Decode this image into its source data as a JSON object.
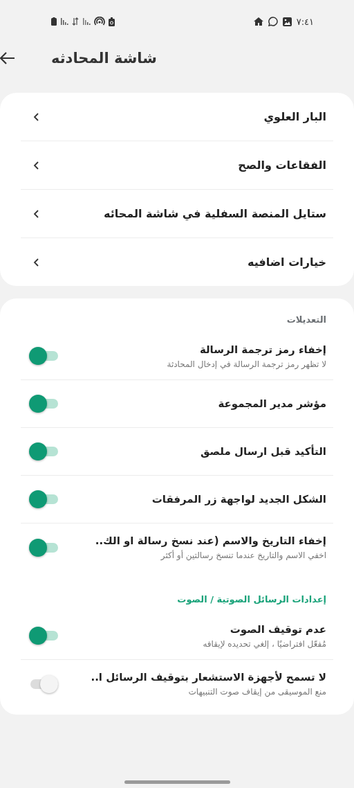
{
  "status_bar": {
    "time": "٧:٤١"
  },
  "header": {
    "title": "شاشة المحادثه"
  },
  "nav_items": [
    {
      "label": "البار العلوي"
    },
    {
      "label": "الفقاعات والصح"
    },
    {
      "label": "ستايل المنصة السفلية في شاشة المحائه"
    },
    {
      "label": "خيارات اضافيه"
    }
  ],
  "settings": [
    {
      "kind": "header",
      "label": "التعديلات",
      "color": "#6b6f73"
    },
    {
      "kind": "toggle",
      "label": "إخفاء رمز ترجمة الرسالة",
      "subtitle": "لا تظهر رمز ترجمة الرسالة في إدخال المحادثة",
      "on": true
    },
    {
      "kind": "toggle",
      "label": "مؤشر مدير المجموعة",
      "on": true
    },
    {
      "kind": "toggle",
      "label": "التأكيد قبل ارسال ملصق",
      "on": true
    },
    {
      "kind": "toggle",
      "label": "الشكل الجديد لواجهة زر المرفقات",
      "on": true
    },
    {
      "kind": "toggle",
      "label": "إخفاء التاريخ والاسم (عند نسخ رسالة او الك..",
      "subtitle": "اخفي الاسم والتاريخ عندما تنسخ رسالتين أو أكثر",
      "on": true
    },
    {
      "kind": "header",
      "label": "إعدادات الرسائل الصوتية / الصوت",
      "color": "#1aa37a"
    },
    {
      "kind": "toggle",
      "label": "عدم توقيف الصوت",
      "subtitle": "مُفعّل افتراضيًا ، إلغي تحديده لإيقافه",
      "on": true
    },
    {
      "kind": "toggle",
      "label": "لا تسمح لأجهزة الاستشعار بتوقيف الرسائل ا..",
      "subtitle": "منع الموسيقى من إيقاف صوت التنبيهات",
      "on": false
    }
  ]
}
